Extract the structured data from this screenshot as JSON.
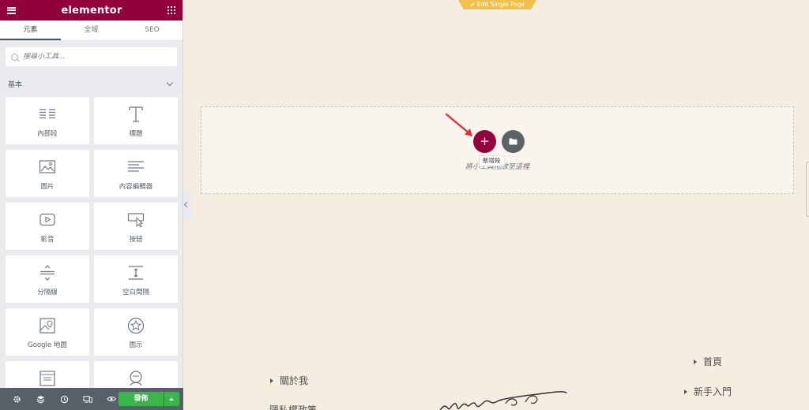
{
  "sidebar": {
    "brand": "elementor",
    "tabs": [
      {
        "label": "元素",
        "active": true
      },
      {
        "label": "全域",
        "active": false
      },
      {
        "label": "SEO",
        "active": false
      }
    ],
    "search_placeholder": "搜尋小工具...",
    "category": "基本",
    "widgets": [
      {
        "label": "內部段",
        "icon": "inner-section-icon"
      },
      {
        "label": "標題",
        "icon": "heading-icon"
      },
      {
        "label": "圖片",
        "icon": "image-icon"
      },
      {
        "label": "內容編輯器",
        "icon": "text-editor-icon"
      },
      {
        "label": "影音",
        "icon": "video-icon"
      },
      {
        "label": "按鈕",
        "icon": "button-icon"
      },
      {
        "label": "分隔線",
        "icon": "divider-icon"
      },
      {
        "label": "空白間隔",
        "icon": "spacer-icon"
      },
      {
        "label": "Google 地圖",
        "icon": "map-icon"
      },
      {
        "label": "圖示",
        "icon": "star-icon"
      },
      {
        "label": "",
        "icon": "widget-icon"
      },
      {
        "label": "",
        "icon": "widget-icon"
      }
    ],
    "publish_label": "發佈"
  },
  "canvas": {
    "edit_tab_label": "Edit Single Page",
    "drop_hint": "將小工具拖放至這裡",
    "add_section_tooltip": "新增段",
    "menu": {
      "about": "關於我",
      "home": "首頁",
      "start": "新手入門",
      "partial": "隱私權政策"
    }
  },
  "colors": {
    "brand": "#92003b",
    "publish": "#39b54a",
    "canvas_bg": "#f5ede0",
    "edit_tab": "#f0c04a"
  }
}
